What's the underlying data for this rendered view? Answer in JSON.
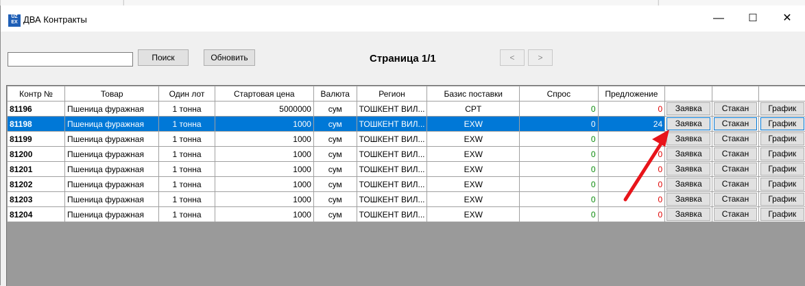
{
  "window": {
    "title": "ДВА Контракты",
    "icon_text_top": "UZ",
    "icon_text_bottom": "EX",
    "minimize_glyph": "—",
    "maximize_glyph": "☐",
    "close_glyph": "✕"
  },
  "toolbar": {
    "search_value": "",
    "search_label": "Поиск",
    "refresh_label": "Обновить",
    "page_label": "Страница 1/1",
    "prev_label": "<",
    "next_label": ">"
  },
  "grid": {
    "columns": [
      "Контр №",
      "Товар",
      "Один лот",
      "Стартовая цена",
      "Валюта",
      "Регион",
      "Базис поставки",
      "Спрос",
      "Предложение",
      "",
      "",
      ""
    ],
    "button_labels": {
      "request": "Заявка",
      "book": "Стакан",
      "chart": "График"
    },
    "rows": [
      {
        "id": "81196",
        "product": "Пшеница фуражная",
        "lot": "1 тонна",
        "price": "5000000",
        "currency": "сум",
        "region": "ТОШКЕНТ ВИЛ...",
        "basis": "CPT",
        "demand": "0",
        "offer": "0"
      },
      {
        "id": "81198",
        "product": "Пшеница фуражная",
        "lot": "1 тонна",
        "price": "1000",
        "currency": "сум",
        "region": "ТОШКЕНТ ВИЛ...",
        "basis": "EXW",
        "demand": "0",
        "offer": "24"
      },
      {
        "id": "81199",
        "product": "Пшеница фуражная",
        "lot": "1 тонна",
        "price": "1000",
        "currency": "сум",
        "region": "ТОШКЕНТ ВИЛ...",
        "basis": "EXW",
        "demand": "0",
        "offer": "0"
      },
      {
        "id": "81200",
        "product": "Пшеница фуражная",
        "lot": "1 тонна",
        "price": "1000",
        "currency": "сум",
        "region": "ТОШКЕНТ ВИЛ...",
        "basis": "EXW",
        "demand": "0",
        "offer": "0"
      },
      {
        "id": "81201",
        "product": "Пшеница фуражная",
        "lot": "1 тонна",
        "price": "1000",
        "currency": "сум",
        "region": "ТОШКЕНТ ВИЛ...",
        "basis": "EXW",
        "demand": "0",
        "offer": "0"
      },
      {
        "id": "81202",
        "product": "Пшеница фуражная",
        "lot": "1 тонна",
        "price": "1000",
        "currency": "сум",
        "region": "ТОШКЕНТ ВИЛ...",
        "basis": "EXW",
        "demand": "0",
        "offer": "0"
      },
      {
        "id": "81203",
        "product": "Пшеница фуражная",
        "lot": "1 тонна",
        "price": "1000",
        "currency": "сум",
        "region": "ТОШКЕНТ ВИЛ...",
        "basis": "EXW",
        "demand": "0",
        "offer": "0"
      },
      {
        "id": "81204",
        "product": "Пшеница фуражная",
        "lot": "1 тонна",
        "price": "1000",
        "currency": "сум",
        "region": "ТОШКЕНТ ВИЛ...",
        "basis": "EXW",
        "demand": "0",
        "offer": "0"
      }
    ],
    "selected_row": 1
  },
  "annotation": {
    "arrow_color": "#e8141a"
  },
  "colors": {
    "selection": "#0078d7",
    "demand": "#0a8a0a",
    "offer": "#e00000"
  }
}
